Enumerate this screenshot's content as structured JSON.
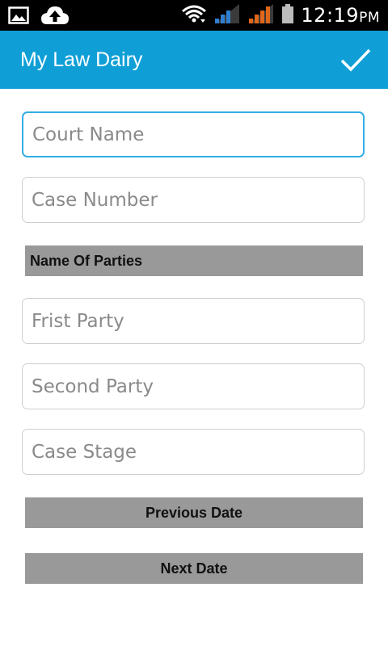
{
  "status_bar": {
    "time": "12:19",
    "ampm": "PM",
    "icons": [
      "image-icon",
      "cloud-upload-icon",
      "wifi-icon",
      "signal-icon",
      "signal-icon-2",
      "battery-icon"
    ]
  },
  "app_bar": {
    "title": "My Law Dairy",
    "action_icon": "checkmark-icon"
  },
  "form": {
    "court_name": {
      "value": "",
      "placeholder": "Court Name"
    },
    "case_number": {
      "value": "",
      "placeholder": "Case Number"
    },
    "parties_header": "Name Of Parties",
    "first_party": {
      "value": "",
      "placeholder": "Frist Party"
    },
    "second_party": {
      "value": "",
      "placeholder": "Second Party"
    },
    "case_stage": {
      "value": "",
      "placeholder": "Case Stage"
    },
    "previous_date_label": "Previous Date",
    "next_date_label": "Next Date"
  },
  "colors": {
    "app_bar": "#0f9fd6",
    "focus_border": "#33aee4",
    "section_bar": "#999999"
  }
}
